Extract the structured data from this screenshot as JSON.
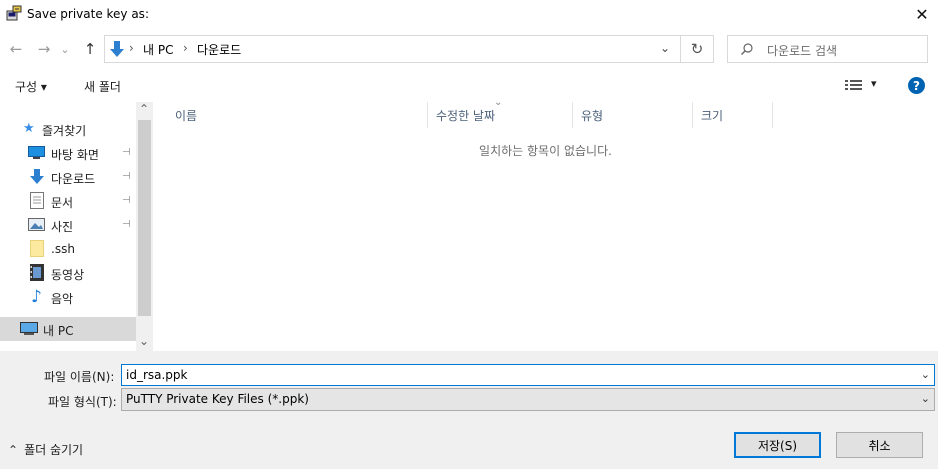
{
  "window": {
    "title": "Save private key as:",
    "close_glyph": "✕"
  },
  "navbar": {
    "back_glyph": "←",
    "forward_glyph": "→",
    "recent_glyph": "⌄",
    "up_glyph": "↑",
    "breadcrumb": {
      "sep": "›",
      "root": "내 PC",
      "current": "다운로드"
    },
    "dropdown_glyph": "⌄",
    "refresh_glyph": "↻",
    "search_placeholder": "다운로드 검색"
  },
  "toolbar": {
    "organize": "구성 ▾",
    "new_folder": "새 폴더",
    "view_glyph": "▾",
    "help_glyph": "?"
  },
  "sidebar": {
    "items": [
      {
        "label": "즐겨찾기",
        "icon": "star-icon"
      },
      {
        "label": "바탕 화면",
        "icon": "desktop-icon",
        "pinned": true
      },
      {
        "label": "다운로드",
        "icon": "download-icon",
        "pinned": true
      },
      {
        "label": "문서",
        "icon": "document-icon",
        "pinned": true
      },
      {
        "label": "사진",
        "icon": "picture-icon",
        "pinned": true
      },
      {
        "label": ".ssh",
        "icon": "folder-icon"
      },
      {
        "label": "동영상",
        "icon": "video-icon"
      },
      {
        "label": "음악",
        "icon": "music-icon"
      },
      {
        "label": "내 PC",
        "icon": "pc-icon",
        "selected": true
      }
    ],
    "pin_glyph": "📌",
    "scroll_up": "⌃",
    "scroll_down": "⌄"
  },
  "filelist": {
    "columns": [
      "이름",
      "수정한 날짜",
      "유형",
      "크기"
    ],
    "sort_glyph": "⌄",
    "empty_message": "일치하는 항목이 없습니다."
  },
  "bottom": {
    "filename_label": "파일 이름(N):",
    "filename_value": "id_rsa.ppk",
    "filetype_label": "파일 형식(T):",
    "filetype_value": "PuTTY Private Key Files (*.ppk)",
    "dd_glyph": "⌄",
    "hide_folders": "폴더 숨기기",
    "hide_glyph": "⌃",
    "save": "저장(S)",
    "cancel": "취소"
  }
}
